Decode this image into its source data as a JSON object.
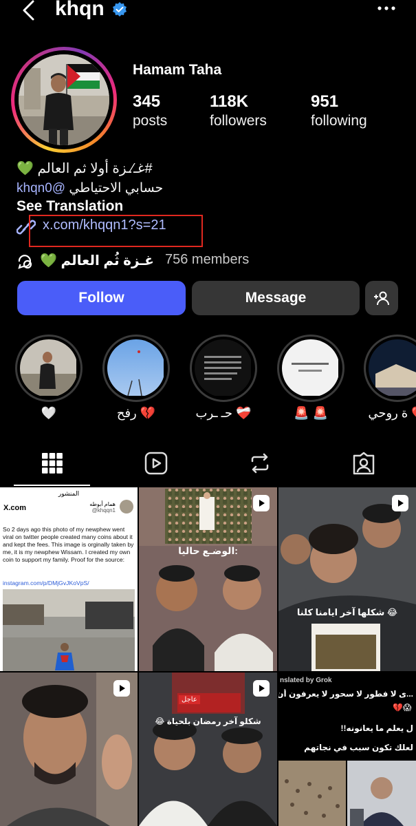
{
  "header": {
    "username": "khqn",
    "verified": true
  },
  "profile": {
    "display_name": "Hamam Taha",
    "stats": [
      {
        "value": "345",
        "label": "posts"
      },
      {
        "value": "118K",
        "label": "followers"
      },
      {
        "value": "951",
        "label": "following"
      }
    ],
    "bio_line1": "#غـ⁄ـزة أولا ثم العالم",
    "bio_line2_prefix": "حسابي الاحتياطي ",
    "bio_line2_mention": "khqn0@",
    "see_translation": "See Translation",
    "link": "x.com/khqqn1?s=21",
    "channel_name": "غـزة ثُم العالم",
    "channel_members": "756 members"
  },
  "actions": {
    "follow": "Follow",
    "message": "Message"
  },
  "highlights": [
    {
      "label": "🤍"
    },
    {
      "label": "رفح 💔"
    },
    {
      "label": "حـ ـرب ❤️‍🩹"
    },
    {
      "label": "🚨 🚨"
    },
    {
      "label": "ة روحي 💔"
    }
  ],
  "tabs": [
    "grid",
    "reels",
    "reposts",
    "tagged"
  ],
  "posts": {
    "post1": {
      "header_ar": "المنشور",
      "account": "X.com",
      "author_ar": "همام أبوطه",
      "handle": "@khqqn1",
      "body": "So 2 days ago this photo of my newphew went viral on twitter people created many coins about it and kept the fees. This image is orginally taken by me, it is my newphew Wissam. I created my own coin to support my family. Proof for the source:",
      "source_link": "instagram.com/p/DMjGvJKoVpS/"
    },
    "post2": {
      "caption_ar": "الوضـع حاليا:"
    },
    "post3": {
      "caption_ar": "شكلها آخر ايامنا كلنا"
    },
    "post5": {
      "news_tag": "عاجل",
      "caption_ar": "شكلو آخر رمضان بلحياة"
    },
    "post6": {
      "translated": "nslated by Grok",
      "line1": "...ى لا فطور لا سحور لا يعرفون أن رمض",
      "line2": "ل يعلم ما يعانونه!!",
      "line3": "لعلك تكون سبب في نجاتهم"
    }
  }
}
